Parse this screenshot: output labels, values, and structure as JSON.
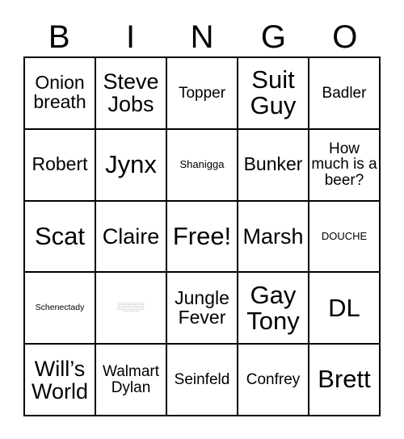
{
  "card": {
    "headers": [
      "B",
      "I",
      "N",
      "G",
      "O"
    ],
    "rows": [
      [
        {
          "text": "Onion breath",
          "size": "fs-lg"
        },
        {
          "text": "Steve Jobs",
          "size": "fs-xl"
        },
        {
          "text": "Topper",
          "size": "fs-md"
        },
        {
          "text": "Suit Guy",
          "size": "fs-xxl"
        },
        {
          "text": "Badler",
          "size": "fs-md"
        }
      ],
      [
        {
          "text": "Robert",
          "size": "fs-lg"
        },
        {
          "text": "Jynx",
          "size": "fs-xxl"
        },
        {
          "text": "Shanigga",
          "size": "fs-xs"
        },
        {
          "text": "Bunker",
          "size": "fs-lg"
        },
        {
          "text": "How much is a beer?",
          "size": "fs-md"
        }
      ],
      [
        {
          "text": "Scat",
          "size": "fs-xxl"
        },
        {
          "text": "Claire",
          "size": "fs-xl"
        },
        {
          "text": "Free!",
          "size": "fs-xxl"
        },
        {
          "text": "Marsh",
          "size": "fs-xl"
        },
        {
          "text": "DOUCHE",
          "size": "fs-xs"
        }
      ],
      [
        {
          "text": "Schenectady",
          "size": "fs-xxs"
        },
        {
          "text": "Lorem ipsum dolor sit amet consectetur adipiscing elit sed do eiusmod tempor incididunt ut labore et dolore magna aliqua ut enim ad minim veniam quis nostrud exercitation ullamco laboris nisi ut aliquip ex ea commodo consequat duis aute irure dolor in reprehenderit in voluptate velit esse cillum dolore eu fugiat nulla pariatur",
          "size": "fs-micro"
        },
        {
          "text": "Jungle Fever",
          "size": "fs-lg"
        },
        {
          "text": "Gay Tony",
          "size": "fs-xxl"
        },
        {
          "text": "DL",
          "size": "fs-xxl"
        }
      ],
      [
        {
          "text": "Will’s World",
          "size": "fs-xl"
        },
        {
          "text": "Walmart Dylan",
          "size": "fs-md"
        },
        {
          "text": "Seinfeld",
          "size": "fs-md"
        },
        {
          "text": "Confrey",
          "size": "fs-md"
        },
        {
          "text": "Brett",
          "size": "fs-xxl"
        }
      ]
    ]
  }
}
